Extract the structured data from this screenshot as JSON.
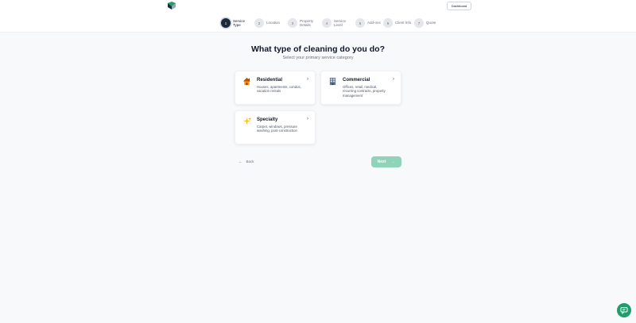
{
  "header": {
    "logo_name": "logo",
    "dashboard_label": "Dashboard"
  },
  "steps": [
    {
      "num": "1",
      "label": "Service Type",
      "active": true
    },
    {
      "num": "2",
      "label": "Location",
      "active": false
    },
    {
      "num": "3",
      "label": "Property Details",
      "active": false
    },
    {
      "num": "4",
      "label": "Service Level",
      "active": false
    },
    {
      "num": "5",
      "label": "Add-ons",
      "active": false
    },
    {
      "num": "6",
      "label": "Client Info",
      "active": false
    },
    {
      "num": "7",
      "label": "Quote",
      "active": false
    }
  ],
  "main": {
    "title": "What type of cleaning do you do?",
    "subtitle": "Select your primary service category"
  },
  "cards": [
    {
      "title": "Residential",
      "desc": "Houses, apartments, condos, vacation rentals",
      "icon": "house-icon",
      "chevron": "›"
    },
    {
      "title": "Commercial",
      "desc": "Offices, retail, medical, recurring contracts, property management",
      "icon": "building-icon",
      "chevron": "›"
    },
    {
      "title": "Specialty",
      "desc": "Carpet, windows, pressure washing, post-construction",
      "icon": "sparkles-icon",
      "chevron": "›"
    }
  ],
  "footer": {
    "back_label": "Back",
    "back_arrow": "←",
    "next_label": "Next",
    "next_arrow": "→"
  },
  "colors": {
    "active_step": "#1e293b",
    "next_button": "#8fd3b9",
    "chat_button": "#1f9d6c"
  }
}
